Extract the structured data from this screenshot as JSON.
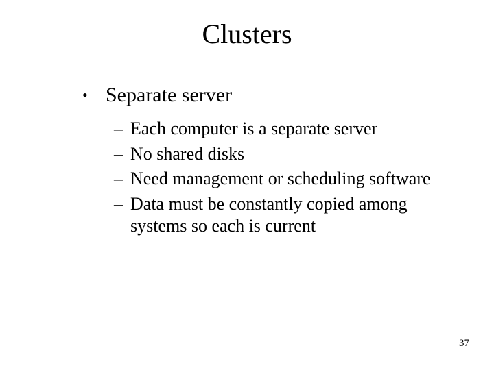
{
  "title": "Clusters",
  "bullet": {
    "text": "Separate server"
  },
  "subs": [
    {
      "text": "Each computer is a separate server"
    },
    {
      "text": "No shared disks"
    },
    {
      "text": "Need management or scheduling software"
    },
    {
      "text": "Data must be constantly copied among systems so each is current"
    }
  ],
  "glyphs": {
    "bullet": "•",
    "dash": "–"
  },
  "page_number": "37"
}
